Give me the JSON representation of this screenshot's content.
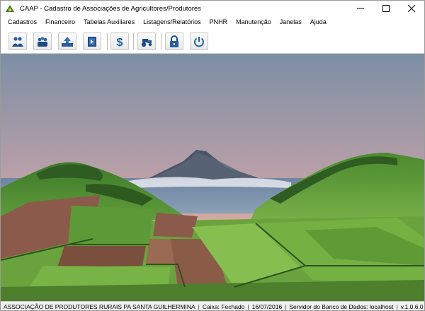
{
  "window": {
    "title": "CAAP - Cadastro de Associações de Agricultores/Produtores"
  },
  "menu": [
    "Cadastros",
    "Financeiro",
    "Tabelas Auxiliares",
    "Listagens/Relatórios",
    "PNHR",
    "Manutenção",
    "Janelas",
    "Ajuda"
  ],
  "toolbar": {
    "icons": [
      "associates-icon",
      "producers-icon",
      "upload-icon",
      "exit-door-icon",
      "dollar-icon",
      "tractor-icon",
      "lock-icon",
      "power-icon"
    ]
  },
  "status": {
    "association": "ASSOCIAÇÃO DE PRODUTORES RURAIS PA SANTA GUILHERMINA",
    "caixa": "Caixa: Fechado",
    "date": "16/07/2016",
    "server": "Servidor do Banco de Dados: localhost",
    "version": "v.1.0.6.0"
  },
  "colors": {
    "accent": "#1f5fa8",
    "sky_top": "#7a8fa6",
    "sky_bottom": "#e7b79a",
    "field": "#5f9a3a"
  }
}
